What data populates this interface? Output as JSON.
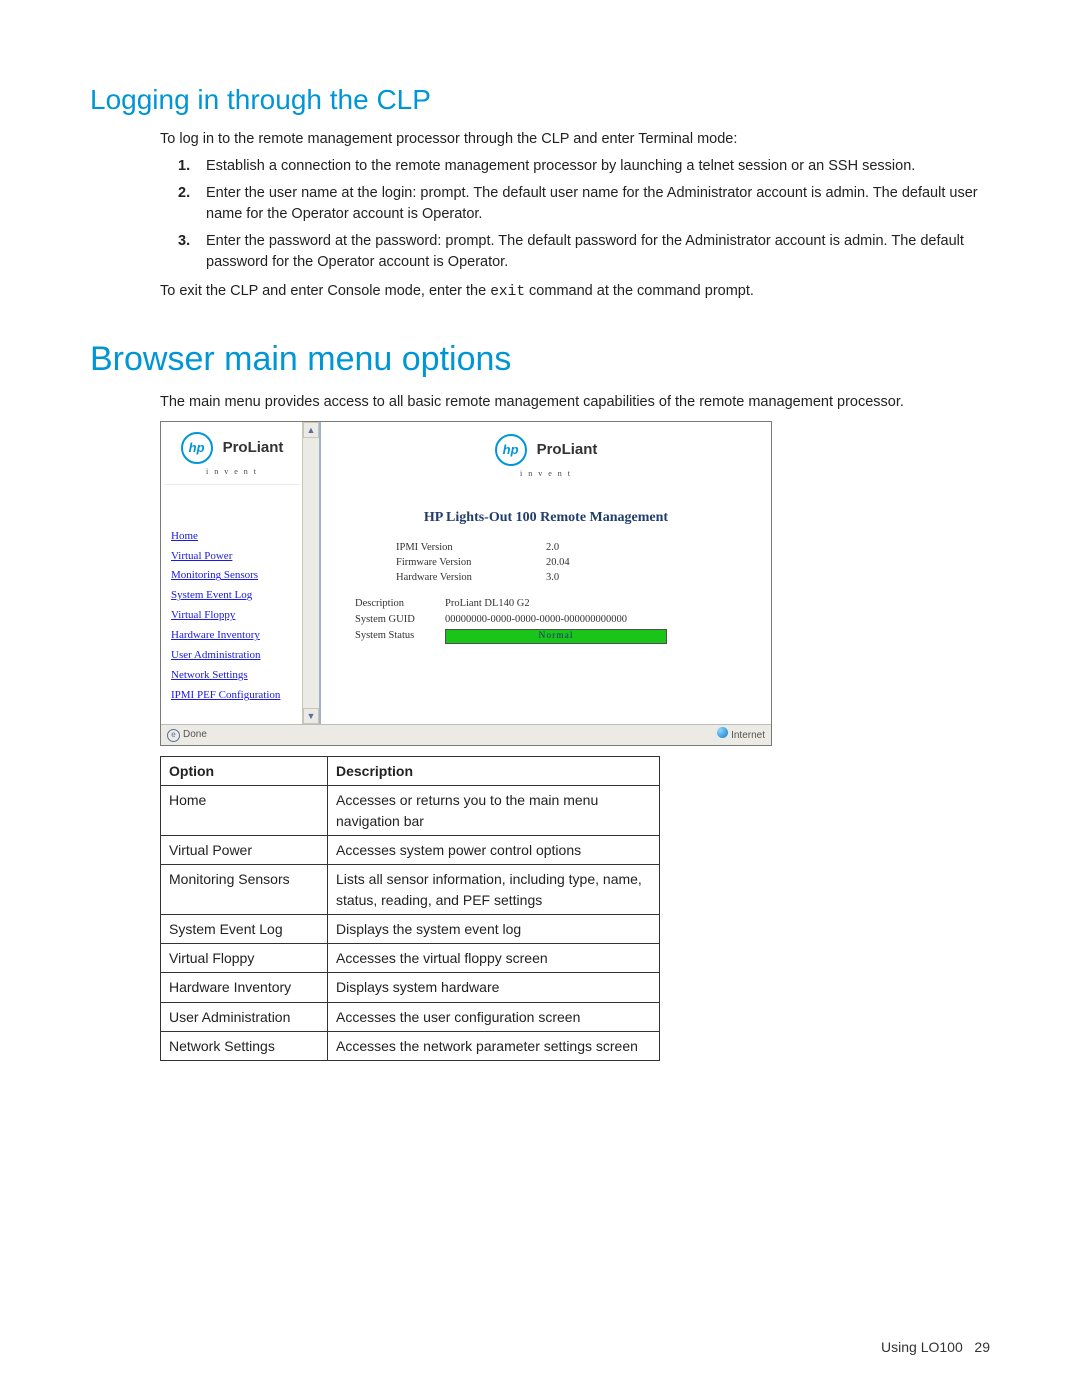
{
  "headings": {
    "h2_clp": "Logging in through the CLP",
    "h1_browser": "Browser main menu options"
  },
  "clp": {
    "intro": "To log in to the remote management processor through the CLP and enter Terminal mode:",
    "step1": "Establish a connection to the remote management processor by launching a telnet session or an SSH session.",
    "step2": "Enter the user name at the login: prompt. The default user name for the Administrator account is admin. The default user name for the Operator account is Operator.",
    "step3": "Enter the password at the password: prompt. The default password for the Administrator account is admin. The default password for the Operator account is Operator.",
    "exit_pre": "To exit the CLP and enter Console mode, enter the ",
    "exit_cmd": "exit",
    "exit_post": " command at the command prompt."
  },
  "browser": {
    "intro": "The main menu provides access to all basic remote management capabilities of the remote management processor."
  },
  "shot": {
    "brand": "ProLiant",
    "logo_sub": "i n v e n t",
    "nav": {
      "home": "Home",
      "vpower": "Virtual Power",
      "sensors": "Monitoring Sensors",
      "sel": "System Event Log",
      "vfloppy": "Virtual Floppy",
      "hwinv": "Hardware Inventory",
      "useradm": "User Administration",
      "netset": "Network Settings",
      "pef": "IPMI PEF Configuration"
    },
    "main_title": "HP Lights-Out 100 Remote Management",
    "info": {
      "ipmi_k": "IPMI Version",
      "ipmi_v": "2.0",
      "fw_k": "Firmware Version",
      "fw_v": "20.04",
      "hw_k": "Hardware Version",
      "hw_v": "3.0"
    },
    "desc": {
      "desc_k": "Description",
      "desc_v": "ProLiant DL140 G2",
      "guid_k": "System GUID",
      "guid_v": "00000000-0000-0000-0000-000000000000",
      "stat_k": "System Status",
      "stat_v": "Normal"
    },
    "status_left": "Done",
    "status_right": "Internet"
  },
  "opts": {
    "head_opt": "Option",
    "head_desc": "Description",
    "rows": [
      {
        "o": "Home",
        "d": "Accesses or returns you to the main menu navigation bar"
      },
      {
        "o": "Virtual Power",
        "d": "Accesses system power control options"
      },
      {
        "o": "Monitoring Sensors",
        "d": "Lists all sensor information, including type, name, status, reading, and PEF settings"
      },
      {
        "o": "System Event Log",
        "d": "Displays the system event log"
      },
      {
        "o": "Virtual Floppy",
        "d": "Accesses the virtual floppy screen"
      },
      {
        "o": "Hardware Inventory",
        "d": "Displays system hardware"
      },
      {
        "o": "User Administration",
        "d": "Accesses the user configuration screen"
      },
      {
        "o": "Network Settings",
        "d": "Accesses the network parameter settings screen"
      }
    ]
  },
  "footer": {
    "section": "Using LO100",
    "page": "29"
  }
}
